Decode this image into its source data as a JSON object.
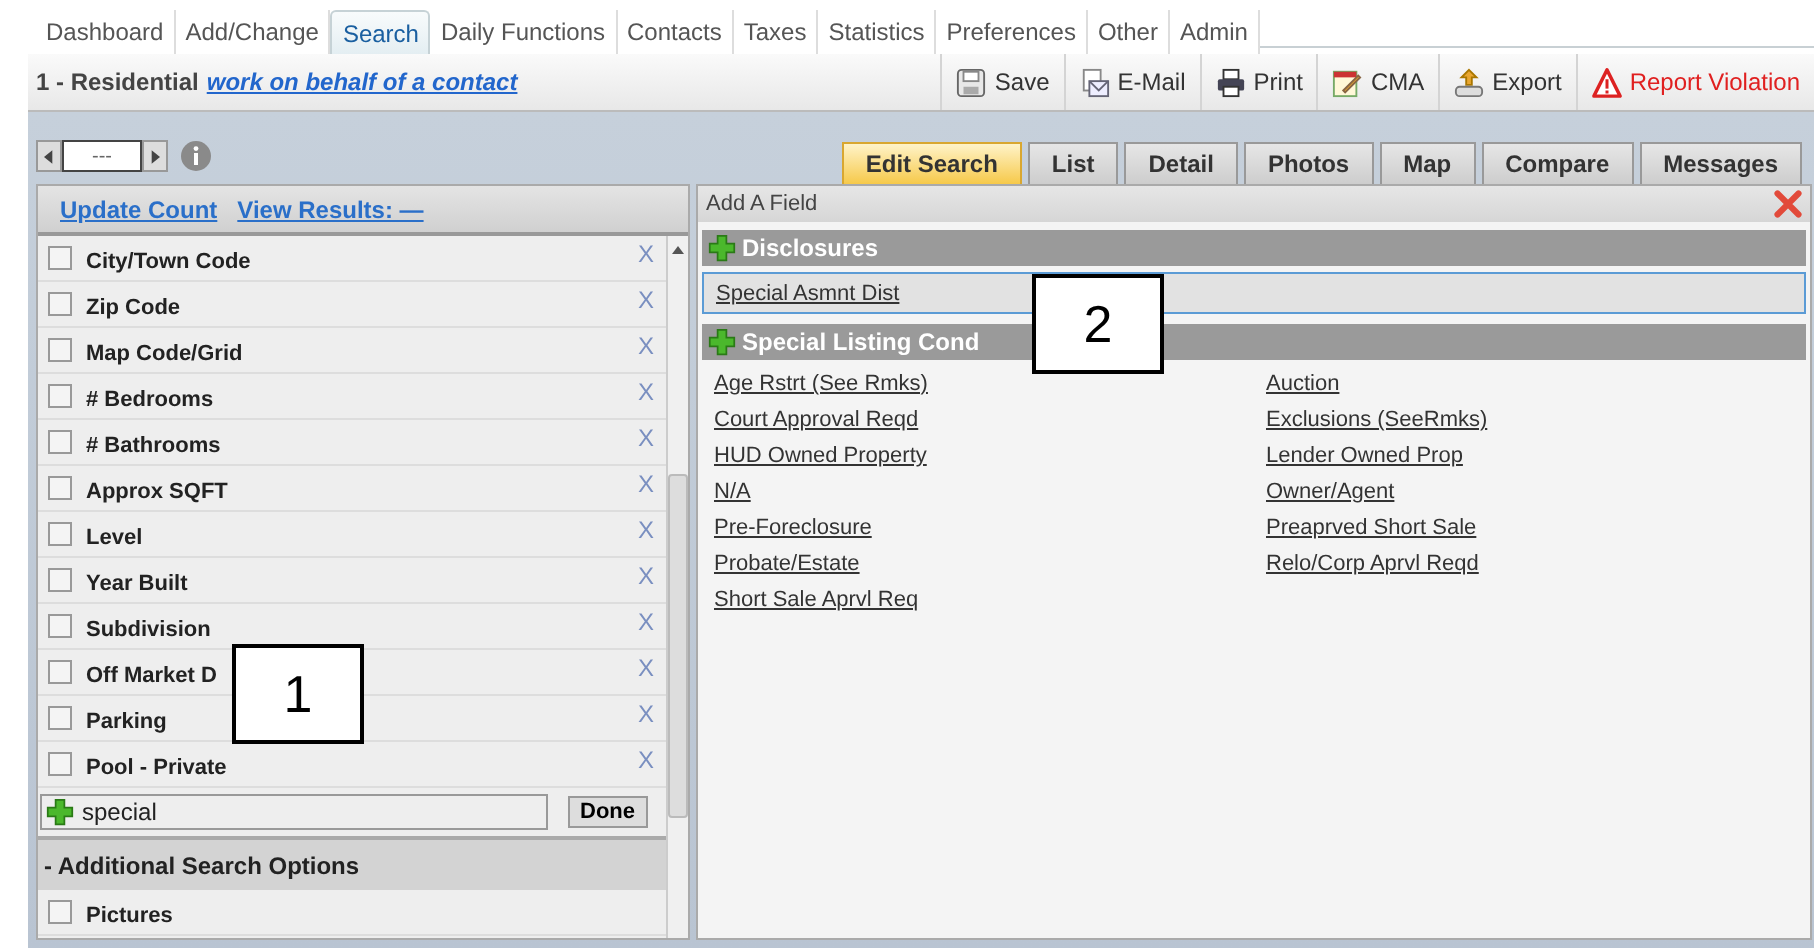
{
  "nav_tabs": [
    {
      "label": "Dashboard",
      "selected": false
    },
    {
      "label": "Add/Change",
      "selected": false
    },
    {
      "label": "Search",
      "selected": true
    },
    {
      "label": "Daily Functions",
      "selected": false
    },
    {
      "label": "Contacts",
      "selected": false
    },
    {
      "label": "Taxes",
      "selected": false
    },
    {
      "label": "Statistics",
      "selected": false
    },
    {
      "label": "Preferences",
      "selected": false
    },
    {
      "label": "Other",
      "selected": false
    },
    {
      "label": "Admin",
      "selected": false
    }
  ],
  "header": {
    "title": "1 - Residential",
    "link": "work on behalf of a contact"
  },
  "toolbar": [
    {
      "kind": "save",
      "label": "Save"
    },
    {
      "kind": "email",
      "label": "E-Mail"
    },
    {
      "kind": "print",
      "label": "Print"
    },
    {
      "kind": "cma",
      "label": "CMA"
    },
    {
      "kind": "export",
      "label": "Export"
    },
    {
      "kind": "report",
      "label": "Report Violation"
    }
  ],
  "pager": {
    "value": "---"
  },
  "view_tabs": [
    {
      "label": "Edit Search",
      "selected": true
    },
    {
      "label": "List",
      "selected": false
    },
    {
      "label": "Detail",
      "selected": false
    },
    {
      "label": "Photos",
      "selected": false
    },
    {
      "label": "Map",
      "selected": false
    },
    {
      "label": "Compare",
      "selected": false
    },
    {
      "label": "Messages",
      "selected": false
    }
  ],
  "search_panel": {
    "links": [
      "Update Count",
      "View Results: —"
    ],
    "fields": [
      {
        "label": "City/Town Code",
        "checked": false,
        "remove": "X"
      },
      {
        "label": "Zip Code",
        "checked": false,
        "remove": "X"
      },
      {
        "label": "Map Code/Grid",
        "checked": false,
        "remove": "X"
      },
      {
        "label": "# Bedrooms",
        "checked": false,
        "remove": "X"
      },
      {
        "label": "# Bathrooms",
        "checked": false,
        "remove": "X"
      },
      {
        "label": "Approx SQFT",
        "checked": false,
        "remove": "X"
      },
      {
        "label": "Level",
        "checked": false,
        "remove": "X"
      },
      {
        "label": "Year Built",
        "checked": false,
        "remove": "X"
      },
      {
        "label": "Subdivision",
        "checked": false,
        "remove": "X"
      },
      {
        "label": "Off Market D",
        "checked": false,
        "remove": "X"
      },
      {
        "label": "Parking",
        "checked": false,
        "remove": "X"
      },
      {
        "label": "Pool - Private",
        "checked": false,
        "remove": "X"
      }
    ],
    "add_field": {
      "value": "special",
      "button": "Done"
    },
    "section": "- Additional Search Options",
    "options": [
      {
        "label": "Pictures",
        "checked": false
      }
    ]
  },
  "add_field_panel": {
    "title": "Add A Field",
    "groups": [
      {
        "name": "Disclosures",
        "items": [
          {
            "label": "Special Asmnt Dist",
            "selected": true
          }
        ]
      },
      {
        "name": "Special Listing Cond",
        "items": [
          {
            "label": "Age Rstrt (See Rmks)",
            "selected": false
          },
          {
            "label": "Court Approval Reqd",
            "selected": false
          },
          {
            "label": "HUD Owned Property",
            "selected": false
          },
          {
            "label": "N/A",
            "selected": false
          },
          {
            "label": "Pre-Foreclosure",
            "selected": false
          },
          {
            "label": "Probate/Estate",
            "selected": false
          },
          {
            "label": "Short Sale Aprvl Req",
            "selected": false
          },
          {
            "label": "Auction",
            "selected": false
          },
          {
            "label": "Exclusions (SeeRmks)",
            "selected": false
          },
          {
            "label": "Lender Owned Prop",
            "selected": false
          },
          {
            "label": "Owner/Agent",
            "selected": false
          },
          {
            "label": "Preaprved Short Sale",
            "selected": false
          },
          {
            "label": "Relo/Corp Aprvl Reqd",
            "selected": false
          }
        ]
      }
    ]
  },
  "callouts": [
    "1",
    "2"
  ]
}
